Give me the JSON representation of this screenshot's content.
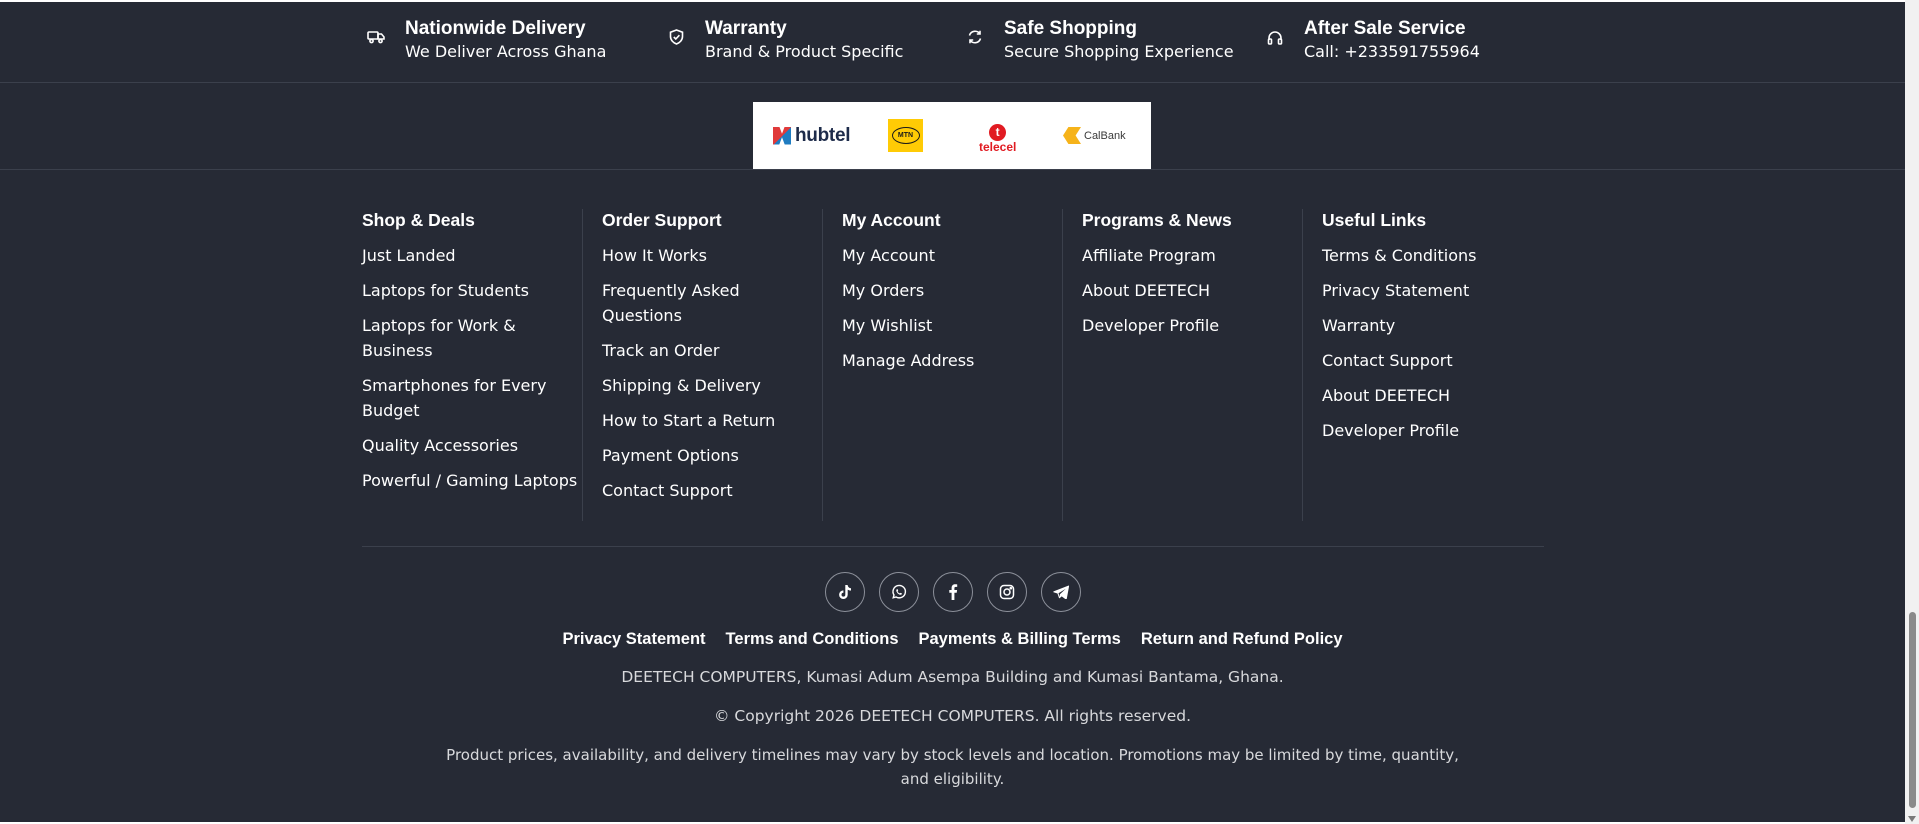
{
  "features": [
    {
      "icon": "truck-icon",
      "title": "Nationwide Delivery",
      "subtitle": "We Deliver Across Ghana"
    },
    {
      "icon": "shield-check-icon",
      "title": "Warranty",
      "subtitle": "Brand & Product Specific"
    },
    {
      "icon": "refresh-icon",
      "title": "Safe Shopping",
      "subtitle": "Secure Shopping Experience"
    },
    {
      "icon": "headphones-icon",
      "title": "After Sale Service",
      "subtitle": "Call: +233591755964"
    }
  ],
  "partners": {
    "hubtel": "hubtel",
    "mtn": "MTN",
    "telecel": "telecel",
    "telecel_mark": "t",
    "calbank": "CalBank"
  },
  "columns": [
    {
      "title": "Shop & Deals",
      "links": [
        "Just Landed",
        "Laptops for Students",
        "Laptops for Work & Business",
        "Smartphones for Every Budget",
        "Quality Accessories",
        "Powerful / Gaming Laptops"
      ]
    },
    {
      "title": "Order Support",
      "links": [
        "How It Works",
        "Frequently Asked Questions",
        "Track an Order",
        "Shipping & Delivery",
        "How to Start a Return",
        "Payment Options",
        "Contact Support"
      ]
    },
    {
      "title": "My Account",
      "links": [
        "My Account",
        "My Orders",
        "My Wishlist",
        "Manage Address"
      ]
    },
    {
      "title": "Programs & News",
      "links": [
        "Affiliate Program",
        "About DEETECH",
        "Developer Profile"
      ]
    },
    {
      "title": "Useful Links",
      "links": [
        "Terms & Conditions",
        "Privacy Statement",
        "Warranty",
        "Contact Support",
        "About DEETECH",
        "Developer Profile"
      ]
    }
  ],
  "socials": [
    "tiktok-icon",
    "whatsapp-icon",
    "facebook-icon",
    "instagram-icon",
    "telegram-icon"
  ],
  "legal_links": [
    "Privacy Statement",
    "Terms and Conditions",
    "Payments & Billing Terms",
    "Return and Refund Policy"
  ],
  "address": "DEETECH COMPUTERS, Kumasi Adum Asempa Building and Kumasi Bantama, Ghana.",
  "copyright": "© Copyright 2026 DEETECH COMPUTERS. All rights reserved.",
  "disclaimer": "Product prices, availability, and delivery timelines may vary by stock levels and location. Promotions may be limited by time, quantity, and eligibility.",
  "colors": {
    "background": "#262a35",
    "divider": "#3b404c",
    "text": "#ffffff",
    "muted_text": "#d8d9dc"
  }
}
